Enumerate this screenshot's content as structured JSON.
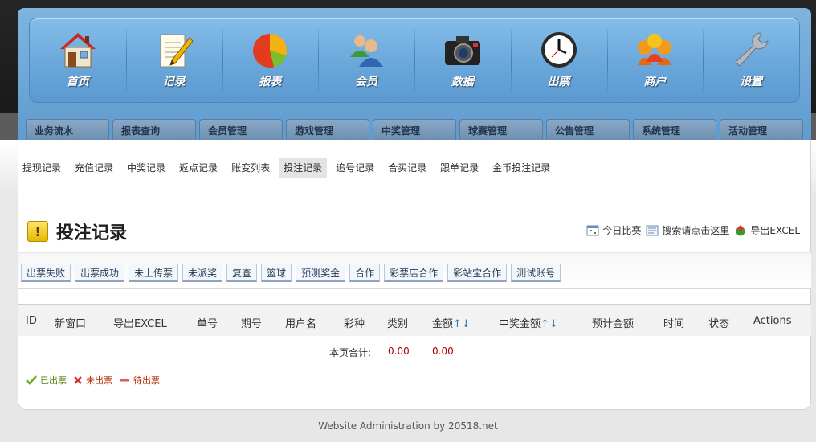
{
  "main_nav": [
    {
      "label": "首页",
      "icon": "home-icon"
    },
    {
      "label": "记录",
      "icon": "notepad-icon"
    },
    {
      "label": "报表",
      "icon": "pie-chart-icon"
    },
    {
      "label": "会员",
      "icon": "users-icon"
    },
    {
      "label": "数据",
      "icon": "camera-icon"
    },
    {
      "label": "出票",
      "icon": "clock-icon"
    },
    {
      "label": "商户",
      "icon": "merchant-icon"
    },
    {
      "label": "设置",
      "icon": "wrench-icon"
    }
  ],
  "category_tabs": [
    "业务流水",
    "报表查询",
    "会员管理",
    "游戏管理",
    "中奖管理",
    "球赛管理",
    "公告管理",
    "系统管理",
    "活动管理"
  ],
  "sub_nav": {
    "items": [
      "提现记录",
      "充值记录",
      "中奖记录",
      "返点记录",
      "账变列表",
      "投注记录",
      "追号记录",
      "合买记录",
      "跟单记录",
      "金币投注记录"
    ],
    "active": "投注记录"
  },
  "page": {
    "title": "投注记录",
    "title_icon": "warning-icon"
  },
  "tools": [
    {
      "label": "今日比赛",
      "icon": "calendar-icon"
    },
    {
      "label": "搜索请点击这里",
      "icon": "search-panel-icon"
    },
    {
      "label": "导出EXCEL",
      "icon": "export-icon"
    }
  ],
  "filters": [
    "出票失败",
    "出票成功",
    "未上传票",
    "未派奖",
    "复查",
    "篮球",
    "预测奖金",
    "合作",
    "彩票店合作",
    "彩站宝合作",
    "测试账号"
  ],
  "table": {
    "headers": [
      "ID",
      "新窗口",
      "导出EXCEL",
      "单号",
      "期号",
      "用户名",
      "彩种",
      "类别",
      "金额",
      "中奖金额",
      "预计金额",
      "时间",
      "状态",
      "Actions"
    ],
    "sort_arrows": "↑↓",
    "summary": {
      "label": "本页合计:",
      "amount": "0.00",
      "win_amount": "0.00"
    }
  },
  "legend": [
    {
      "label": "已出票",
      "icon": "check-icon"
    },
    {
      "label": "未出票",
      "icon": "cross-icon"
    },
    {
      "label": "待出票",
      "icon": "minus-icon"
    }
  ],
  "footer": "Website Administration by 20518.net",
  "colors": {
    "accent": "#6aa7da",
    "tab": "#7d9dbd",
    "money": "#b00000"
  }
}
